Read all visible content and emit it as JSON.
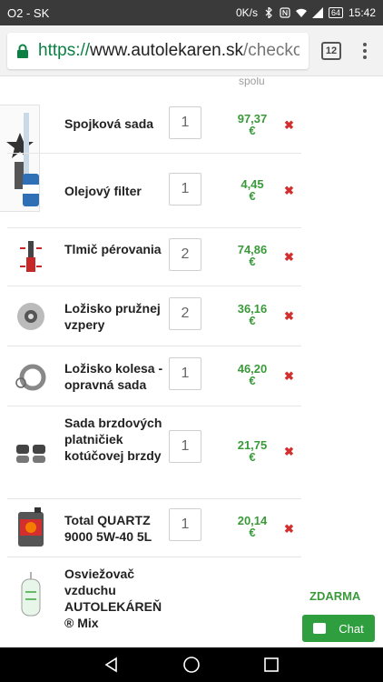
{
  "status_bar": {
    "carrier": "O2 - SK",
    "net_speed": "0K/s",
    "battery": "64",
    "time": "15:42"
  },
  "browser": {
    "url_scheme": "https://",
    "url_host": "www.autolekaren.sk",
    "url_path": "/checko",
    "tab_count": "12"
  },
  "cart": {
    "column_header": "spolu",
    "delete_symbol": "✖",
    "items": [
      {
        "name": "Spojková sada",
        "qty": "1",
        "price_value": "97,37",
        "currency": "€",
        "icon": "clutch-kit-icon"
      },
      {
        "name": "Olejový filter",
        "qty": "1",
        "price_value": "4,45",
        "currency": "€",
        "icon": "oil-filter-icon"
      },
      {
        "name": "Tlmič pérovania",
        "qty": "2",
        "price_value": "74,86",
        "currency": "€",
        "icon": "shock-absorber-icon"
      },
      {
        "name": "Ložisko pružnej vzpery",
        "qty": "2",
        "price_value": "36,16",
        "currency": "€",
        "icon": "strut-bearing-icon"
      },
      {
        "name": "Ložisko kolesa - opravná sada",
        "qty": "1",
        "price_value": "46,20",
        "currency": "€",
        "icon": "wheel-bearing-icon"
      },
      {
        "name": "Sada brzdových platničiek kotúčovej brzdy",
        "qty": "1",
        "price_value": "21,75",
        "currency": "€",
        "icon": "brake-pads-icon"
      },
      {
        "name": "Total QUARTZ 9000 5W-40 5L",
        "qty": "1",
        "price_value": "20,14",
        "currency": "€",
        "icon": "engine-oil-icon"
      }
    ],
    "free_item": {
      "name": "Osviežovač vzduchu AUTOLEKÁREŇ ® Mix",
      "price": "ZDARMA",
      "icon": "air-freshener-icon"
    }
  },
  "chat_button": {
    "label": "Chat"
  },
  "colors": {
    "accent_green": "#3a9a3a",
    "delete_red": "#d32f2f",
    "chat_green": "#2e9e3e"
  }
}
